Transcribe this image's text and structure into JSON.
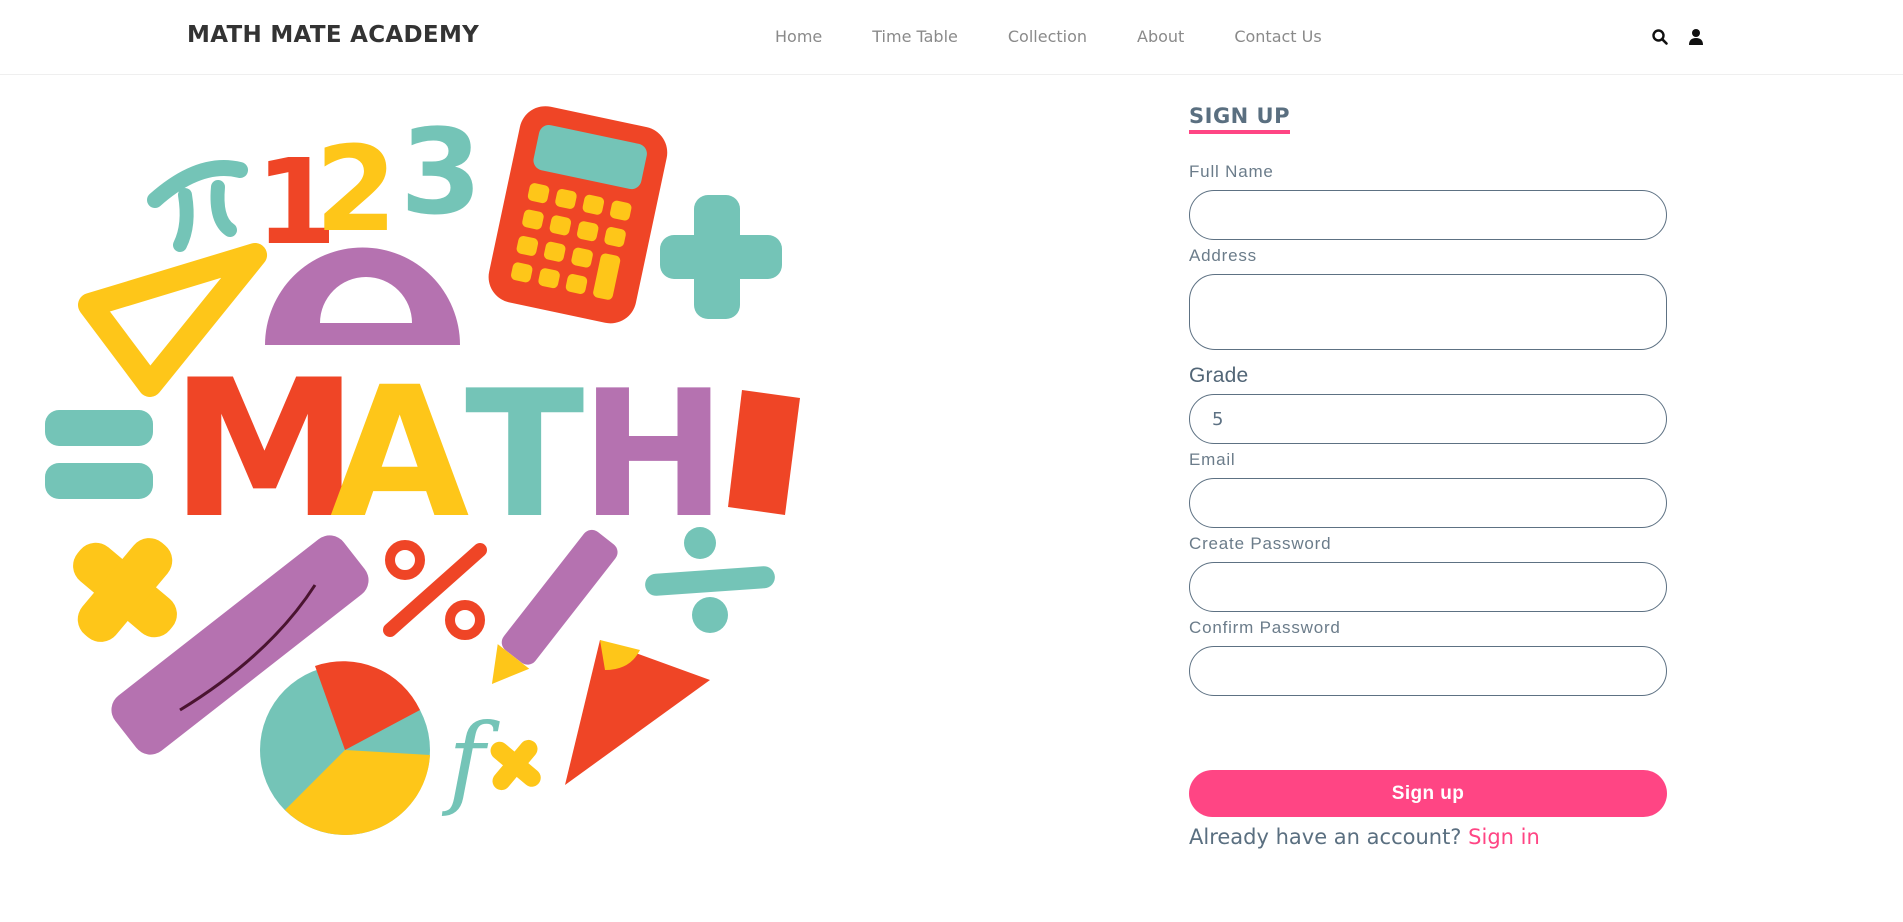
{
  "header": {
    "brand": "MATH MATE ACADEMY",
    "nav": [
      "Home",
      "Time Table",
      "Collection",
      "About",
      "Contact Us"
    ],
    "icons": [
      "search-icon",
      "user-icon"
    ]
  },
  "hero_art": {
    "letters": "MATH!",
    "numbers": "123",
    "symbols": [
      "π",
      "%",
      "fx",
      "+",
      "×",
      "="
    ]
  },
  "form": {
    "title": "SIGN UP",
    "full_name_label": "Full Name",
    "full_name_value": "",
    "address_label": "Address",
    "address_value": "",
    "grade_label": "Grade",
    "grade_value": "5",
    "email_label": "Email",
    "email_value": "",
    "create_password_label": "Create Password",
    "confirm_password_label": "Confirm Password",
    "submit_label": "Sign up",
    "account_prompt": "Already have an account?",
    "signin_link": "Sign in"
  },
  "colors": {
    "accent": "#ff4584",
    "text": "#5a6f80",
    "teal": "#74c4b7",
    "yellow": "#fec619",
    "red": "#ef4526",
    "purple": "#b572b0"
  }
}
